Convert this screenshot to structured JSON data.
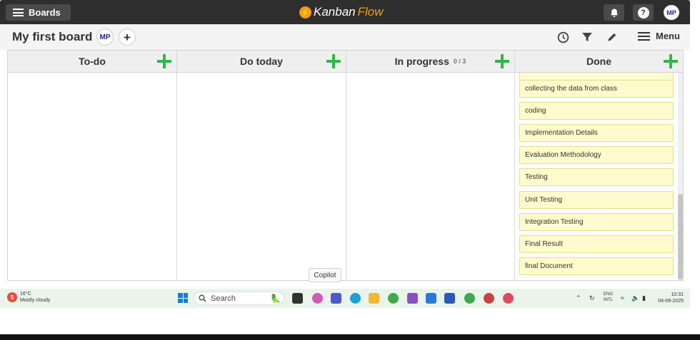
{
  "topbar": {
    "boards_label": "Boards",
    "logo_part1": "Kanban",
    "logo_part2": "Flow",
    "avatar_initials": "MP",
    "help_label": "?"
  },
  "board": {
    "title": "My first board",
    "member_initials": "MP",
    "add_member_label": "+",
    "menu_label": "Menu"
  },
  "columns": [
    {
      "name": "To-do",
      "wip": ""
    },
    {
      "name": "Do today",
      "wip": ""
    },
    {
      "name": "In progress",
      "wip": "0 / 3"
    },
    {
      "name": "Done",
      "wip": ""
    }
  ],
  "done_cards": [
    "collecting the data from class",
    "coding",
    "Implementation Details",
    "Evaluation Methodology",
    "Testing",
    "Unit Testing",
    "Integration Testing",
    "Final Result",
    "final Document"
  ],
  "tooltip": "Copilot",
  "taskbar": {
    "weather_badge": "5",
    "temperature": "16°C",
    "weather_desc": "Mostly cloudy",
    "search_placeholder": "Search",
    "lang_line1": "ENG",
    "lang_line2": "INTL",
    "time": "10:31",
    "date": "04-08-2025"
  },
  "colors": {
    "topbar": "#2e2e2e",
    "logo_accent": "#f39c12",
    "add_card_green": "#2eb84a",
    "card_bg": "#fffbcc",
    "card_border": "#e8dc86",
    "avatar_text": "#1b2a8f"
  }
}
